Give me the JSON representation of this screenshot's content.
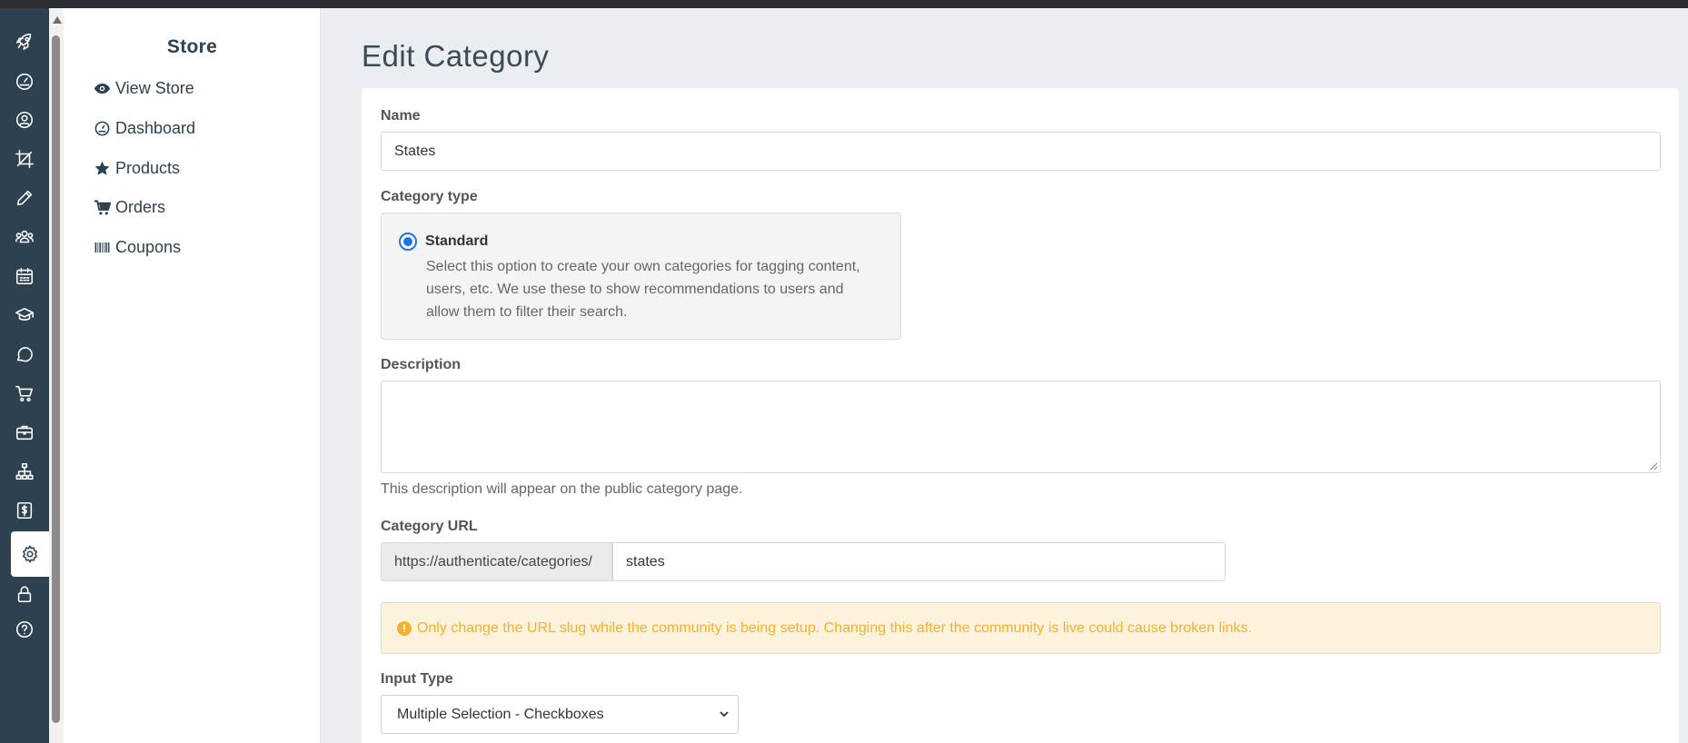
{
  "subnav": {
    "title": "Store",
    "items": [
      {
        "label": "View Store",
        "icon": "eye-icon"
      },
      {
        "label": "Dashboard",
        "icon": "dashboard-icon"
      },
      {
        "label": "Products",
        "icon": "star-icon"
      },
      {
        "label": "Orders",
        "icon": "cart-icon"
      },
      {
        "label": "Coupons",
        "icon": "barcode-icon"
      }
    ]
  },
  "rail": {
    "icons": [
      "rocket-icon",
      "gauge-icon",
      "user-circle-icon",
      "crop-icon",
      "pencil-icon",
      "users-icon",
      "calendar-icon",
      "graduation-cap-icon",
      "chat-icon",
      "cart-icon",
      "briefcase-icon",
      "sitemap-icon",
      "dollar-icon",
      "gear-icon",
      "lock-icon",
      "help-icon"
    ],
    "active": "gear-icon"
  },
  "main": {
    "title": "Edit Category",
    "name_label": "Name",
    "name_value": "States",
    "category_type_label": "Category type",
    "standard_label": "Standard",
    "standard_desc": "Select this option to create your own categories for tagging content, users, etc. We use these to show recommendations to users and allow them to filter their search.",
    "description_label": "Description",
    "description_value": "",
    "description_help": "This description will appear on the public category page.",
    "url_label": "Category URL",
    "url_prefix": "https://authenticate/categories/",
    "url_slug": "states",
    "alert_text": "Only change the URL slug while the community is being setup. Changing this after the community is live could cause broken links.",
    "input_type_label": "Input Type",
    "input_type_value": "Multiple Selection - Checkboxes"
  },
  "colors": {
    "rail_bg": "#2e4150",
    "radio_accent": "#1a73e8",
    "alert_text": "#f2b12d",
    "alert_bg": "#fdf3dd"
  }
}
